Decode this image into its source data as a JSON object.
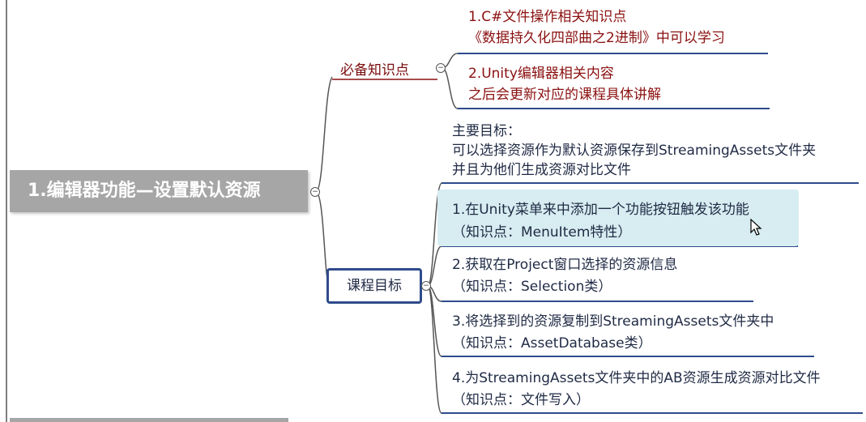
{
  "root": {
    "title": "1.编辑器功能—设置默认资源"
  },
  "prereq": {
    "label": "必备知识点",
    "items": [
      {
        "line1": "1.C#文件操作相关知识点",
        "line2": "《数据持久化四部曲之2进制》中可以学习"
      },
      {
        "line1": "2.Unity编辑器相关内容",
        "line2": "之后会更新对应的课程具体讲解"
      }
    ]
  },
  "goals": {
    "label": "课程目标",
    "main_goal": {
      "line1": "主要目标：",
      "line2": "可以选择资源作为默认资源保存到StreamingAssets文件夹",
      "line3": "并且为他们生成资源对比文件"
    },
    "items": [
      {
        "line1": "1.在Unity菜单来中添加一个功能按钮触发该功能",
        "line2": "（知识点：MenuItem特性）"
      },
      {
        "line1": "2.获取在Project窗口选择的资源信息",
        "line2": "（知识点：Selection类）"
      },
      {
        "line1": "3.将选择到的资源复制到StreamingAssets文件夹中",
        "line2": "（知识点：AssetDatabase类）"
      },
      {
        "line1": "4.为StreamingAssets文件夹中的AB资源生成资源对比文件",
        "line2": "（知识点：文件写入）"
      }
    ]
  },
  "colors": {
    "root_bg": "#a6a6a6",
    "prereq_text": "#8b1010",
    "goal_line": "#2f4b8c",
    "highlight": "#d7edf1"
  },
  "icons": [
    "collapse-minus-icon",
    "mouse-cursor-icon"
  ]
}
